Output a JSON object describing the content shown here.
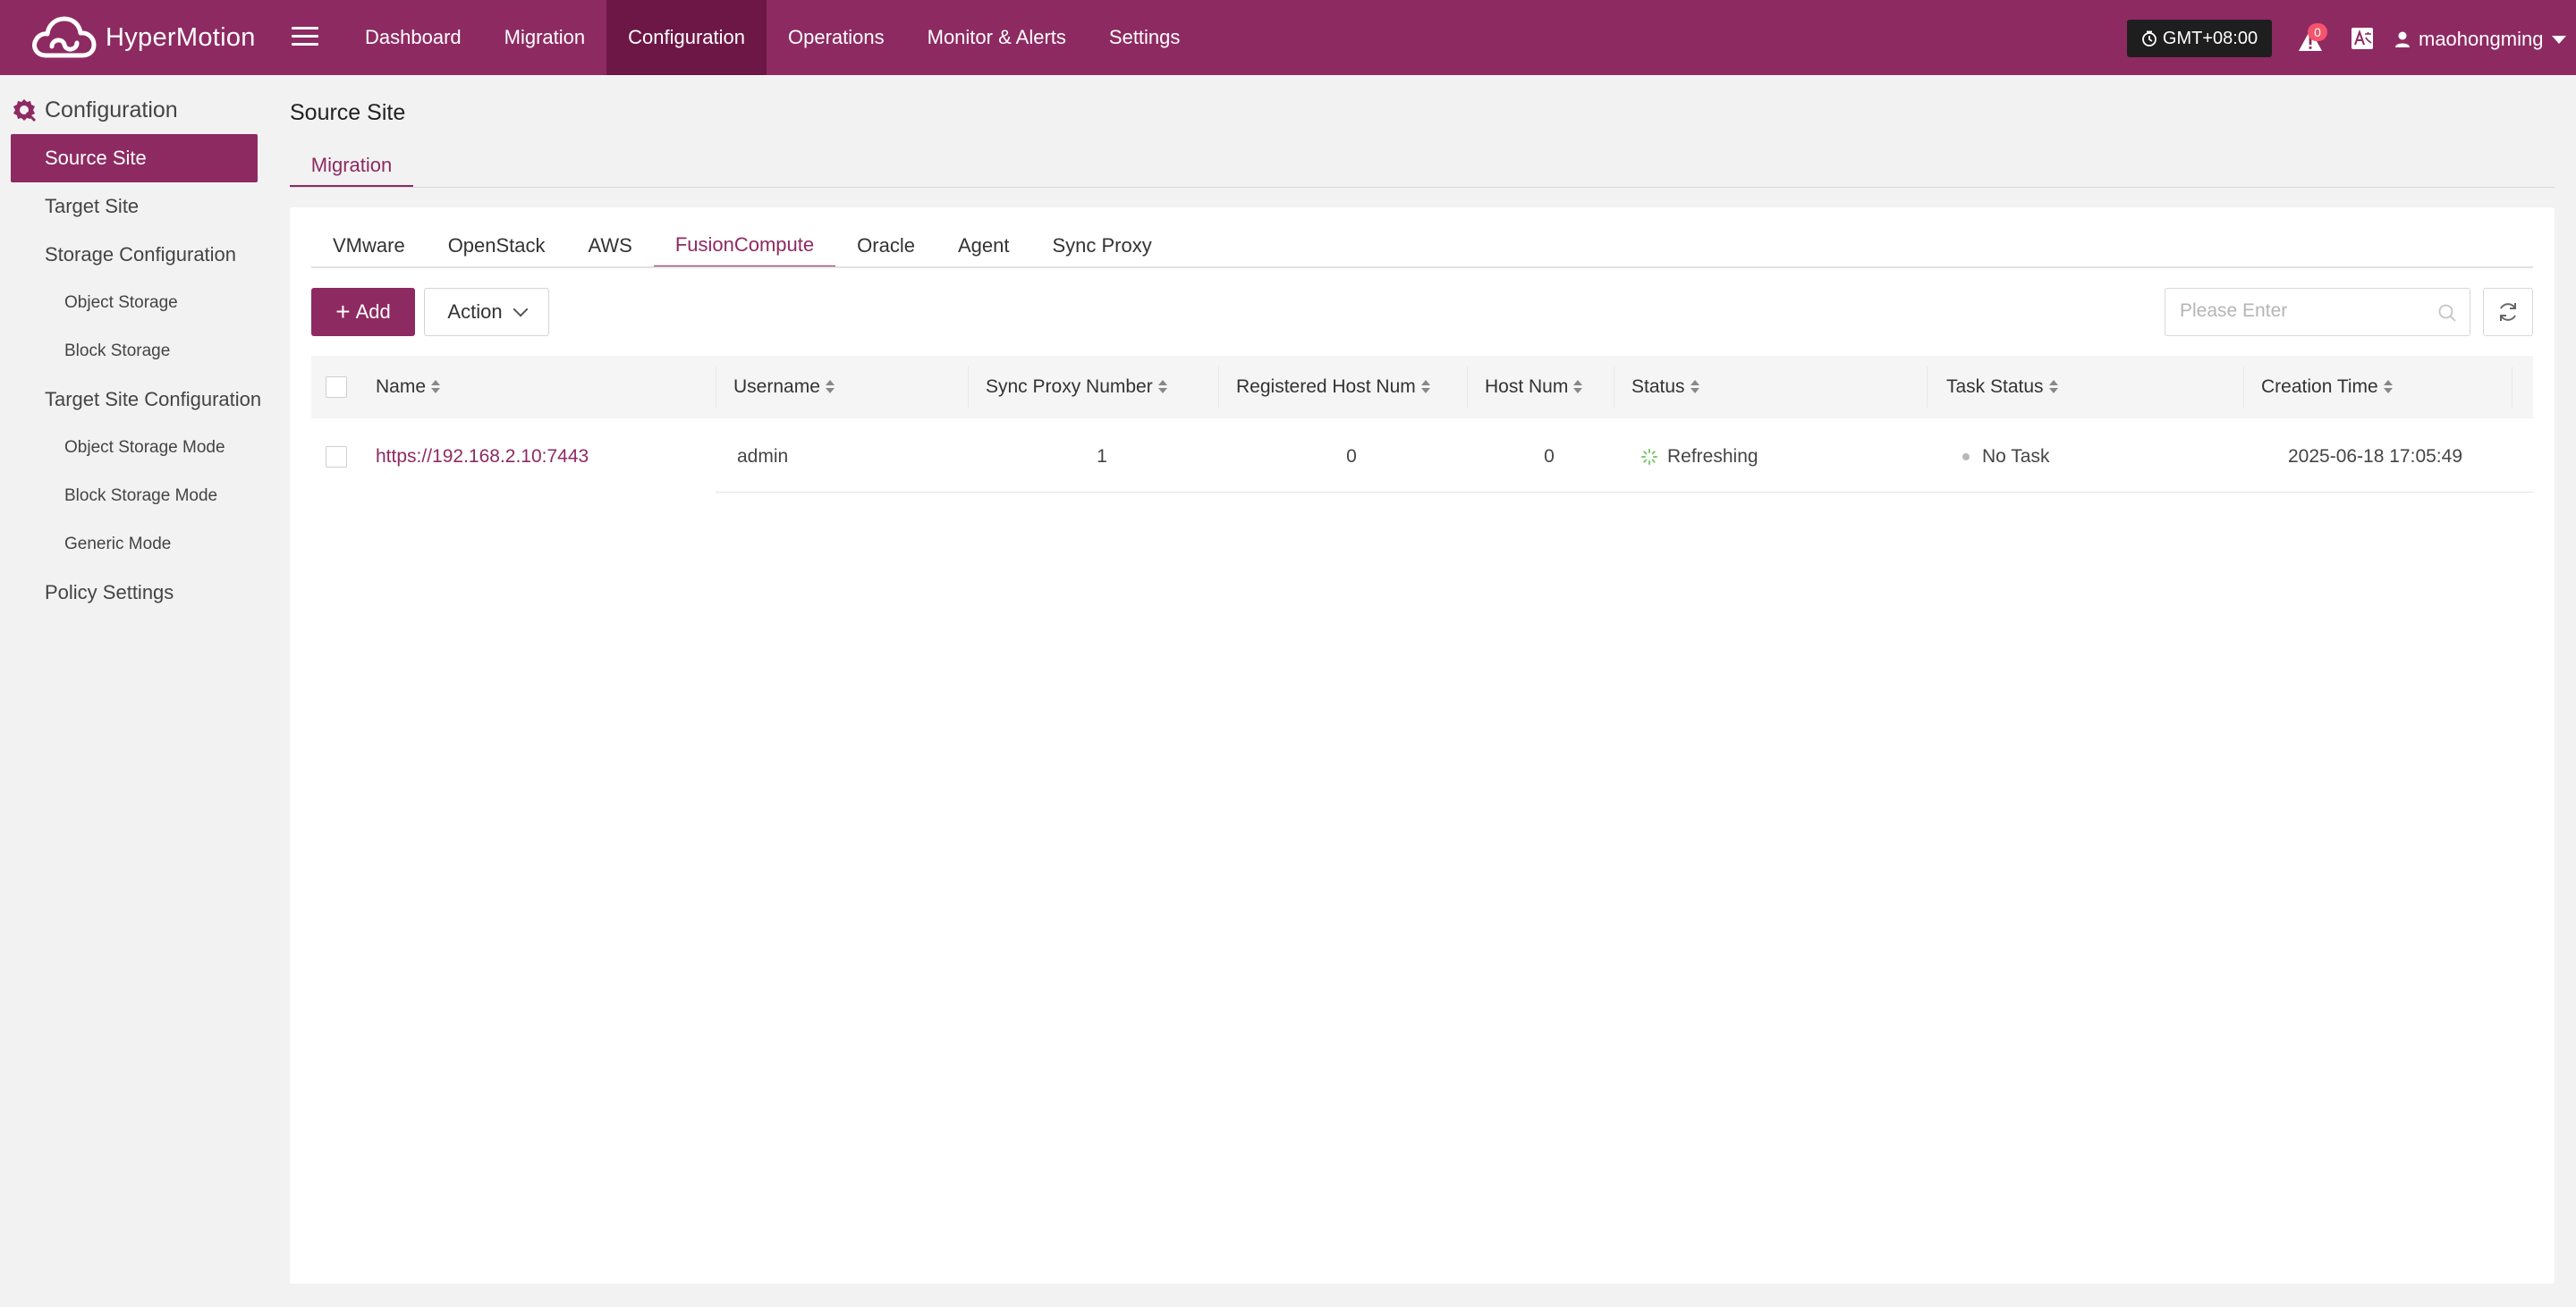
{
  "app": {
    "name": "HyperMotion"
  },
  "topnav": {
    "items": [
      {
        "label": "Dashboard"
      },
      {
        "label": "Migration"
      },
      {
        "label": "Configuration",
        "active": true
      },
      {
        "label": "Operations"
      },
      {
        "label": "Monitor & Alerts"
      },
      {
        "label": "Settings"
      }
    ]
  },
  "header": {
    "timezone": "GMT+08:00",
    "alert_count": "0",
    "username": "maohongming"
  },
  "sidebar": {
    "title": "Configuration",
    "items": [
      {
        "label": "Source Site",
        "active": true
      },
      {
        "label": "Target Site"
      },
      {
        "label": "Storage Configuration"
      },
      {
        "label": "Object Storage"
      },
      {
        "label": "Block Storage"
      },
      {
        "label": "Target Site Configuration"
      },
      {
        "label": "Object Storage Mode"
      },
      {
        "label": "Block Storage Mode"
      },
      {
        "label": "Generic Mode"
      },
      {
        "label": "Policy Settings"
      }
    ]
  },
  "page": {
    "title": "Source Site",
    "subtab": "Migration"
  },
  "platform_tabs": [
    "VMware",
    "OpenStack",
    "AWS",
    "FusionCompute",
    "Oracle",
    "Agent",
    "Sync Proxy"
  ],
  "active_tab": "FusionCompute",
  "toolbar": {
    "add_label": "Add",
    "action_label": "Action",
    "search_placeholder": "Please Enter"
  },
  "table": {
    "columns": [
      "Name",
      "Username",
      "Sync Proxy Number",
      "Registered Host Num",
      "Host Num",
      "Status",
      "Task Status",
      "Creation Time"
    ],
    "rows": [
      {
        "name": "https://192.168.2.10:7443",
        "username": "admin",
        "sync_proxy_number": "1",
        "registered_host_num": "0",
        "host_num": "0",
        "status": "Refreshing",
        "task_status": "No Task",
        "creation_time": "2025-06-18 17:05:49"
      }
    ]
  },
  "colors": {
    "brand": "#8e2a62",
    "nav_active": "#6d1747",
    "badge": "#f5546c",
    "spinner": "#7cc96a"
  }
}
